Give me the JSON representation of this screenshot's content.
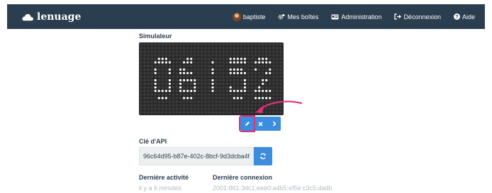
{
  "navbar": {
    "brand": "lenuage",
    "items": [
      {
        "label": "baptiste",
        "icon": "avatar"
      },
      {
        "label": "Mes boîtes",
        "icon": "gears-icon"
      },
      {
        "label": "Administration",
        "icon": "id-card-icon"
      },
      {
        "label": "Déconnexion",
        "icon": "sign-out-icon"
      },
      {
        "label": "Aide",
        "icon": "question-circle-icon"
      }
    ]
  },
  "simulator": {
    "title": "Simulateur",
    "display_text": "06:52",
    "colors": {
      "on": "#ffffff",
      "off": "#3f3f3f",
      "background": "#2a2a2a"
    }
  },
  "controls": {
    "buttons": [
      {
        "name": "edit-button",
        "icon": "pencil-icon"
      },
      {
        "name": "close-button",
        "icon": "times-icon"
      },
      {
        "name": "next-button",
        "icon": "chevron-right-icon"
      }
    ],
    "highlight_color": "#e0317d"
  },
  "api": {
    "title": "Clé d'API",
    "key": "96c64d95-b87e-402c-8bcf-9d3dcba4f"
  },
  "info": {
    "last_activity_label": "Dernière activité",
    "last_activity_value": "il y a 6 minutes",
    "last_connection_label": "Dernière connexion",
    "last_connection_value": "2001:861:3dc1:eee0:a4b5:ef5e:c3c5:dadb"
  },
  "colors": {
    "navbar": "#2b3e50",
    "primary": "#3c8dde",
    "text": "#2b3e50",
    "muted": "#b2bcc4"
  }
}
